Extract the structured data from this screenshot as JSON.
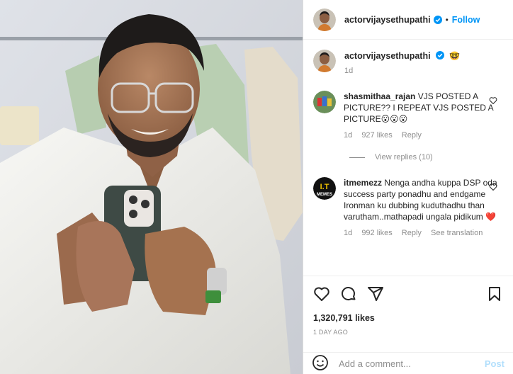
{
  "post": {
    "username": "actorvijaysethupathi",
    "follow_label": "Follow",
    "dot": "•",
    "caption_emoji": "🤓",
    "caption_time": "1d",
    "likes": "1,320,791 likes",
    "ago": "1 DAY AGO"
  },
  "comments": [
    {
      "username": "shasmithaa_rajan",
      "text": "VJS POSTED A PICTURE?? I REPEAT VJS POSTED A PICTURE😮😮😮",
      "time": "1d",
      "likes": "927 likes",
      "reply": "Reply"
    },
    {
      "username": "itmemezz",
      "text": "Nenga andha kuppa DSP oda success party ponadhu and endgame Ironman ku dubbing kuduthadhu than varutham..mathapadi ungala pidikum ❤️",
      "time": "1d",
      "likes": "992 likes",
      "reply": "Reply",
      "translate": "See translation"
    }
  ],
  "view_replies": "View replies (10)",
  "add_comment": {
    "placeholder": "Add a comment...",
    "post_label": "Post"
  },
  "icons": [
    "verified-icon",
    "heart-icon",
    "comment-icon",
    "share-icon",
    "bookmark-icon",
    "emoji-icon"
  ],
  "colors": {
    "accent": "#0095f6",
    "muted": "#8e8e8e",
    "text": "#262626"
  }
}
